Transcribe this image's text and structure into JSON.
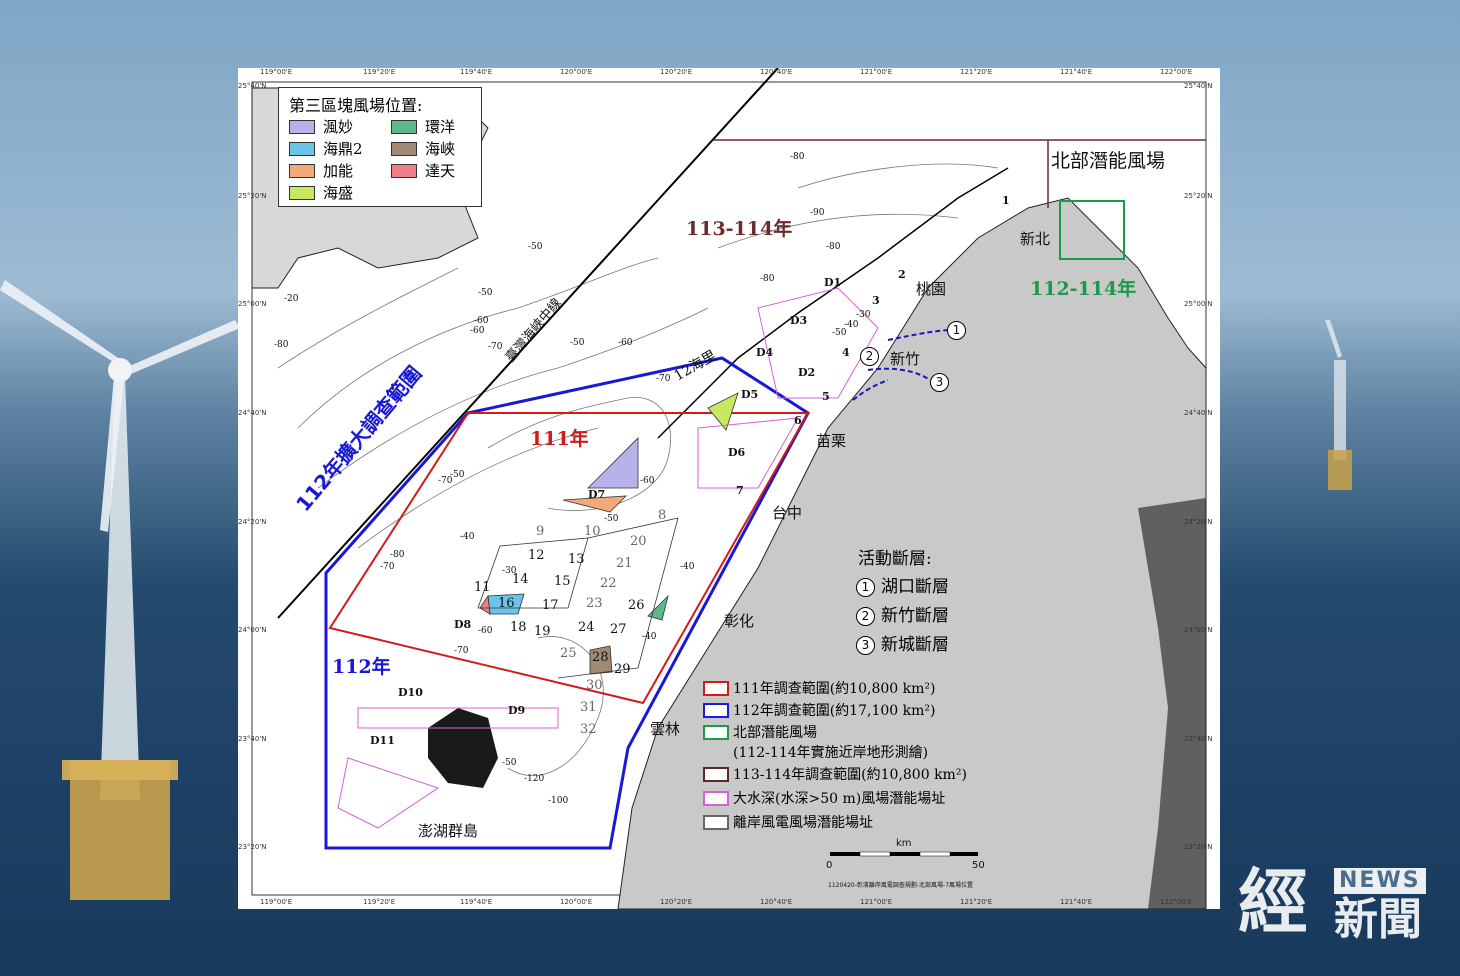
{
  "map": {
    "legend_title": "第三區塊風場位置:",
    "legend_items": [
      {
        "label": "渢妙",
        "color": "#b6b2ea"
      },
      {
        "label": "海鼎2",
        "color": "#6cc4ea"
      },
      {
        "label": "加能",
        "color": "#f4a97a"
      },
      {
        "label": "海盛",
        "color": "#c8e860"
      },
      {
        "label": "環洋",
        "color": "#5fb889"
      },
      {
        "label": "海峽",
        "color": "#a08a74"
      },
      {
        "label": "達天",
        "color": "#f07f88"
      }
    ],
    "lat_labels": [
      "25°40'N",
      "25°20'N",
      "25°00'N",
      "24°40'N",
      "24°20'N",
      "24°00'N",
      "23°40'N",
      "23°20'N"
    ],
    "lon_labels": [
      "119°00'E",
      "119°20'E",
      "119°40'E",
      "120°00'E",
      "120°20'E",
      "120°40'E",
      "121°00'E",
      "121°20'E",
      "121°40'E",
      "122°00'E"
    ],
    "labels": {
      "survey_112_expand": "112年擴大調查範圍",
      "strait_median": "臺灣海峽中線",
      "twelve_nm": "12海里",
      "year_113_114": "113-114年",
      "year_111": "111年",
      "year_112": "112年",
      "north_potential": "北部潛能風場",
      "year_112_114": "112-114年",
      "xinbei": "新北",
      "taoyuan": "桃園",
      "hsinchu": "新竹",
      "miaoli": "苗栗",
      "taichung": "台中",
      "changhua": "彰化",
      "yunlin": "雲林",
      "penghu": "澎湖群島",
      "km": "km",
      "scale_0": "0",
      "scale_50": "50",
      "footnote": "1120420-彰濱離岸風電調查規劃-北部風場-7風場位置"
    },
    "zones": [
      "D1",
      "D2",
      "D3",
      "D4",
      "D5",
      "D6",
      "D7",
      "D8",
      "D9",
      "D10",
      "D11",
      "8",
      "9",
      "10",
      "11",
      "12",
      "13",
      "14",
      "15",
      "16",
      "17",
      "18",
      "19",
      "20",
      "21",
      "22",
      "23",
      "24",
      "25",
      "26",
      "27",
      "28",
      "29",
      "30",
      "31",
      "32",
      "1",
      "2",
      "3",
      "4",
      "5",
      "6",
      "7"
    ],
    "depth_labels": [
      "-80",
      "-90",
      "-80",
      "-80",
      "-70",
      "-60",
      "-50",
      "-50",
      "-50",
      "-60",
      "-70",
      "-70",
      "-60",
      "-50",
      "-40",
      "-40",
      "-30",
      "-40",
      "-50",
      "-60",
      "-70",
      "-80",
      "-70",
      "-100",
      "-120",
      "-50",
      "-80",
      "-60",
      "-50",
      "-40",
      "-30",
      "-20"
    ],
    "fault": {
      "title": "活動斷層:",
      "items": [
        {
          "num": "1",
          "label": "湖口斷層"
        },
        {
          "num": "2",
          "label": "新竹斷層"
        },
        {
          "num": "3",
          "label": "新城斷層"
        }
      ]
    },
    "legend2": [
      {
        "label": "111年調查範圍(約10,800 km²)",
        "color": "#d11a1a"
      },
      {
        "label": "112年調查範圍(約17,100 km²)",
        "color": "#1a1ad8"
      },
      {
        "label": "北部潛能風場",
        "color": "#1a9a4a"
      },
      {
        "label": "(112-114年實施近岸地形測繪)",
        "color": ""
      },
      {
        "label": "113-114年調查範圍(約10,800 km²)",
        "color": "#5a2a2a"
      },
      {
        "label": "大水深(水深>50 m)風場潛能場址",
        "color": "#d660d6"
      },
      {
        "label": "離岸風電風場潛能場址",
        "color": "#666666"
      }
    ]
  },
  "logo": {
    "news": "NEWS",
    "big": "經",
    "small": "新聞"
  }
}
